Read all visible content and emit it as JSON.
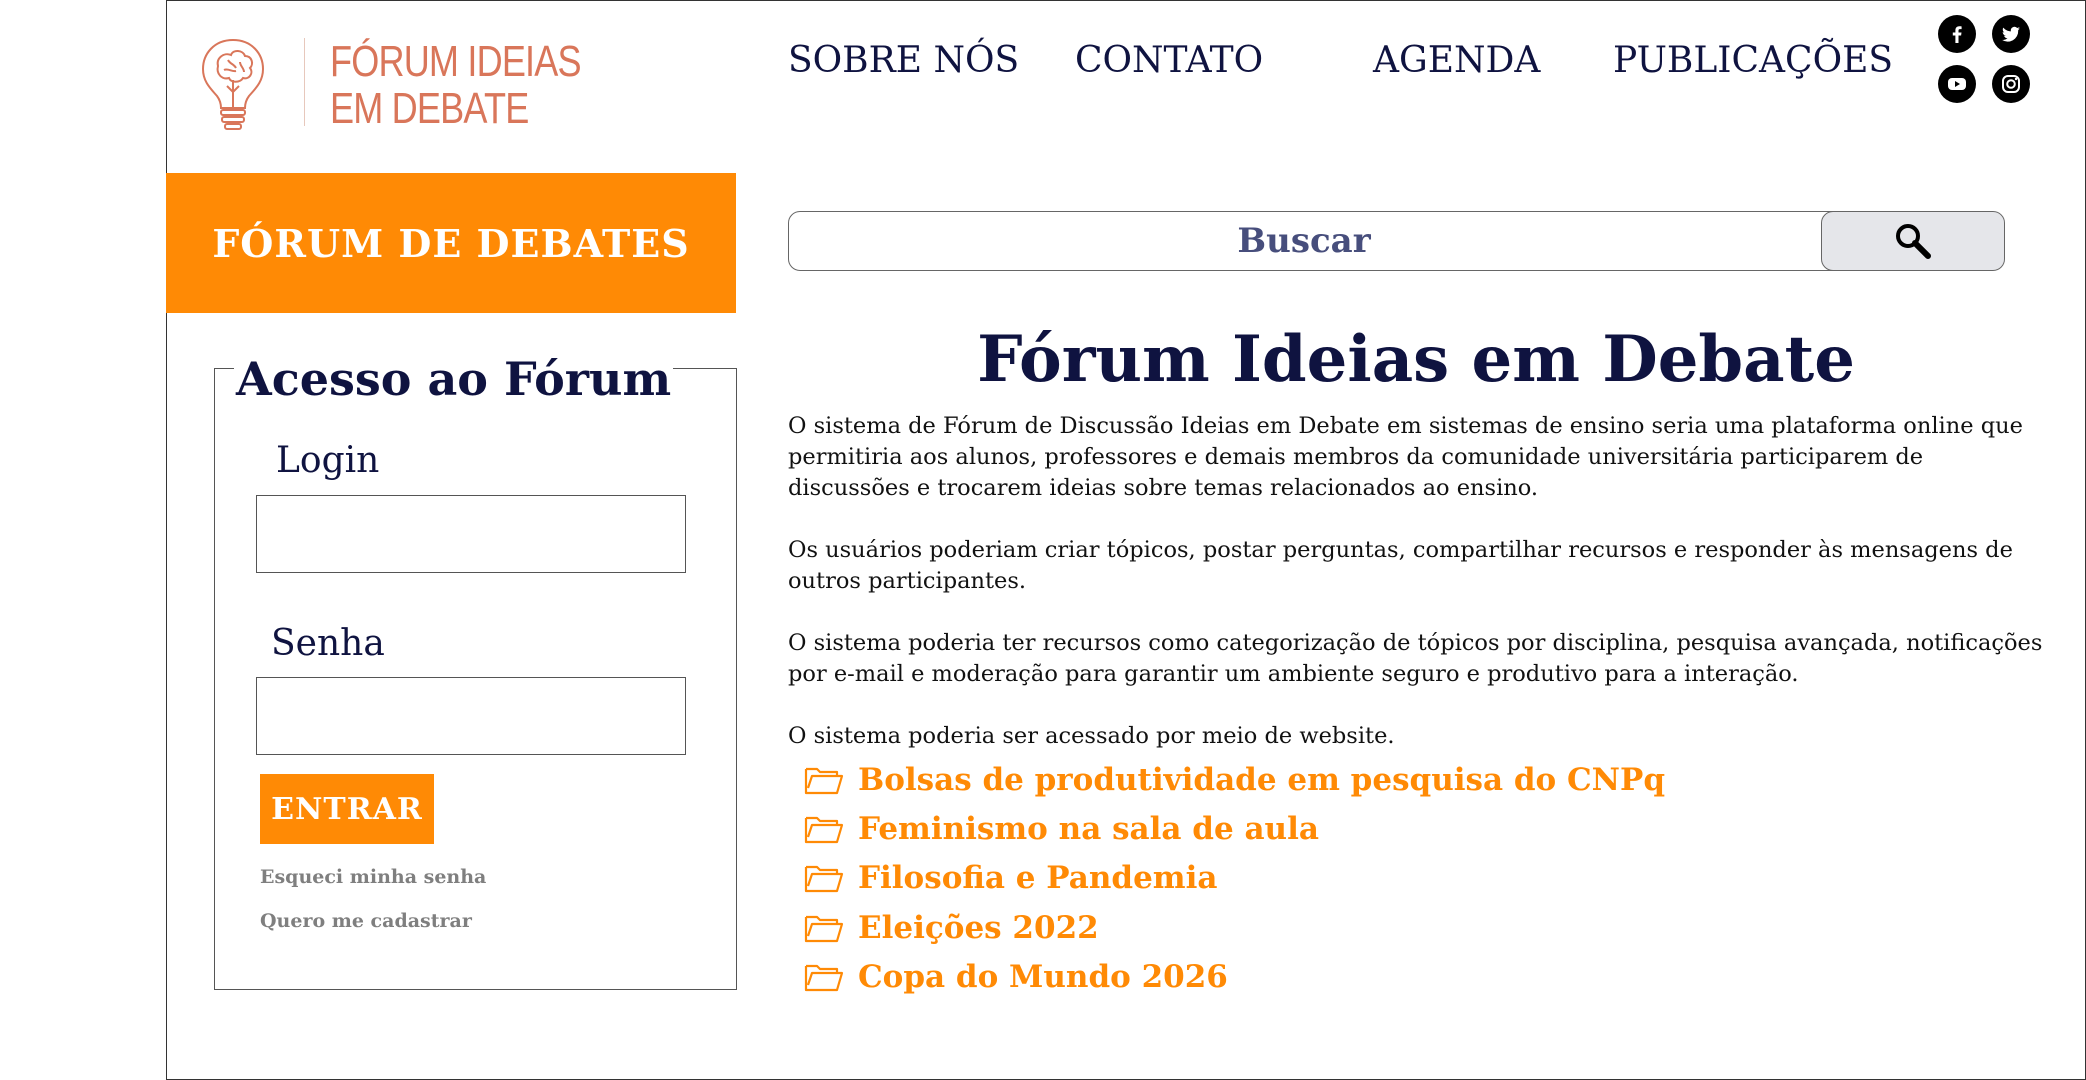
{
  "header": {
    "logo_text": [
      "FÓRUM IDEIAS",
      "EM DEBATE"
    ],
    "nav": [
      "SOBRE NÓS",
      "CONTATO",
      "AGENDA",
      "PUBLICAÇÕES"
    ],
    "social": [
      "facebook-icon",
      "twitter-icon",
      "youtube-icon",
      "instagram-icon"
    ]
  },
  "sidebar": {
    "banner_label": "FÓRUM DE DEBATES",
    "login": {
      "title": "Acesso ao Fórum",
      "login_label": "Login",
      "login_value": "",
      "password_label": "Senha",
      "password_value": "",
      "submit_label": "ENTRAR",
      "forgot_label": "Esqueci minha senha",
      "register_label": "Quero me cadastrar"
    }
  },
  "search": {
    "placeholder": "Buscar",
    "icon": "search-icon"
  },
  "main": {
    "title": "Fórum Ideias em Debate",
    "paragraphs": [
      "O sistema de Fórum de Discussão Ideias em Debate em sistemas de ensino seria uma plataforma online que permitiria aos alunos, professores e demais membros da comunidade universitária participarem de discussões e trocarem ideias sobre temas relacionados ao ensino.",
      "Os usuários poderiam criar tópicos, postar perguntas, compartilhar recursos e responder às mensagens de outros participantes.",
      "O sistema poderia ter recursos como categorização de tópicos por disciplina, pesquisa avançada, notificações por e-mail e moderação para garantir um ambiente seguro e produtivo para a interação.",
      "O sistema poderia ser acessado por meio de website."
    ],
    "topics": [
      "Bolsas de produtividade em pesquisa do CNPq",
      "Feminismo na sala de aula",
      "Filosofia e Pandemia",
      "Eleições 2022",
      "Copa do Mundo 2026"
    ]
  },
  "colors": {
    "accent": "#ff8a05",
    "navy": "#0f1340",
    "logo": "#d9765a"
  }
}
